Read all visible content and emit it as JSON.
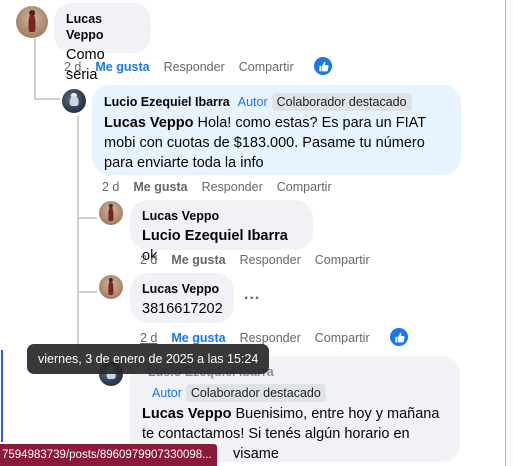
{
  "comments": [
    {
      "author": "Lucas Veppo",
      "text": "Como seria",
      "time": "2 d",
      "like": "Me gusta",
      "reply": "Responder",
      "share": "Compartir"
    },
    {
      "author": "Lucio Ezequiel Ibarra",
      "author_badge": "Autor",
      "top_badge": "Colaborador destacado",
      "mention": "Lucas Veppo",
      "text_line1": " Hola! como estas? Es para un FIAT",
      "text_line2": "mobi con cuotas de $183.000. Pasame tu número",
      "text_line3": "para enviarte toda la info",
      "time": "2 d",
      "like": "Me gusta",
      "reply": "Responder",
      "share": "Compartir"
    },
    {
      "author": "Lucas Veppo",
      "mention": "Lucio Ezequiel Ibarra",
      "text": " ok",
      "time": "2 d",
      "like": "Me gusta",
      "reply": "Responder",
      "share": "Compartir"
    },
    {
      "author": "Lucas Veppo",
      "text": "3816617202",
      "more": "...",
      "time": "2 d",
      "like": "Me gusta",
      "reply": "Responder",
      "share": "Compartir"
    },
    {
      "author": "Lucio Ezequiel Ibarra",
      "author_badge": "Autor",
      "top_badge": "Colaborador destacado",
      "mention": "Lucas Veppo",
      "text_line1": " Buenisimo, entre hoy y mañana",
      "text_line2": "te contactamos! Si tenés algún horario en",
      "text_line3": "visame"
    }
  ],
  "tooltip": "viernes, 3 de enero de 2025 a las 15:24",
  "status_url": "7594983739/posts/8960979907330098...",
  "colors": {
    "like_active": "#1877f2",
    "bubble": "#f0f2f5",
    "bubble_highlight": "#e7f3ff",
    "status_bar": "#8b1a3a"
  }
}
